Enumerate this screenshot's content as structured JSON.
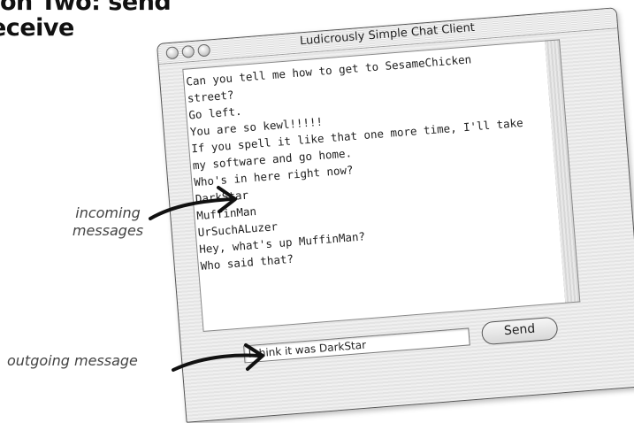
{
  "book_heading": {
    "line1": "on Two: send",
    "line2": "eceive"
  },
  "annotations": {
    "incoming_line1": "incoming",
    "incoming_line2": "messages",
    "outgoing": "outgoing message"
  },
  "window": {
    "title": "Ludicrously Simple Chat Client"
  },
  "chat": {
    "lines": [
      "Can you tell me how to get to SesameChicken",
      "street?",
      "Go left.",
      "You are so kewl!!!!!",
      "If you spell it like that one more time, I'll take",
      "my software and go home.",
      "Who's in here right now?",
      "DarkStar",
      "MuffinMan",
      "UrSuchALuzer",
      "Hey, what's up MuffinMan?",
      "Who said that?"
    ]
  },
  "compose": {
    "input_value": "I think it was DarkStar",
    "send_label": "Send"
  }
}
